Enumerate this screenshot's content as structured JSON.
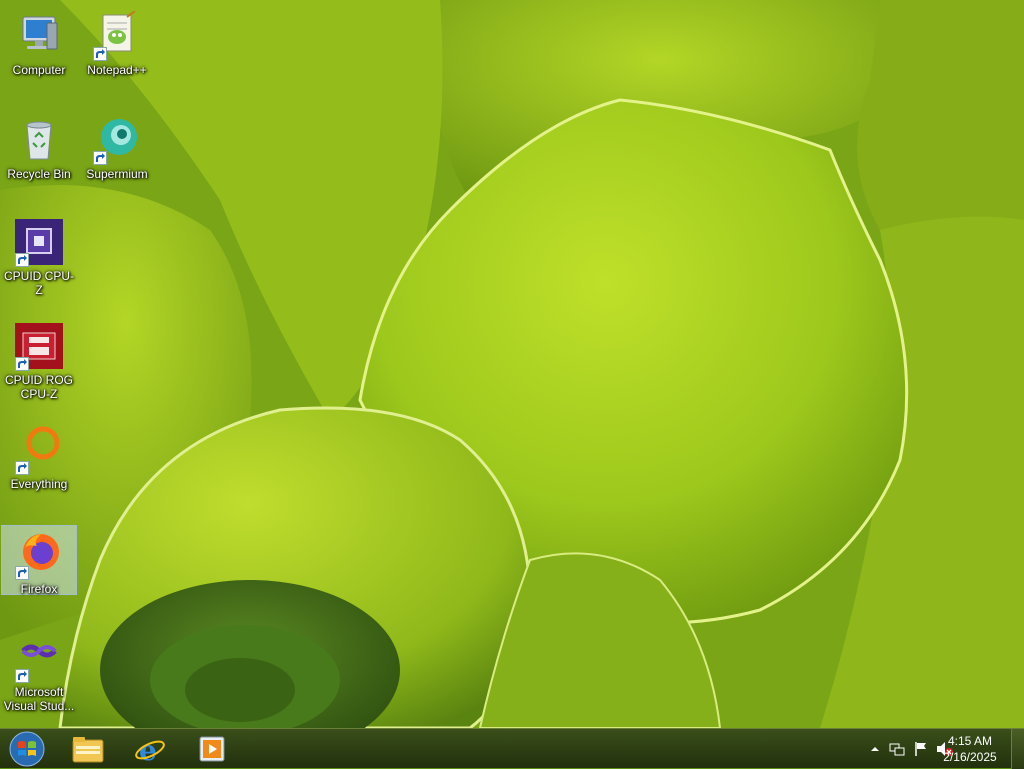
{
  "desktop": {
    "icons": [
      {
        "label": "Computer",
        "icon": "computer-icon"
      },
      {
        "label": "Notepad++",
        "icon": "notepadpp-icon"
      },
      {
        "label": "Recycle Bin",
        "icon": "recycle-bin-icon"
      },
      {
        "label": "Supermium",
        "icon": "supermium-icon"
      },
      {
        "label": "CPUID CPU-Z",
        "icon": "cpuz-icon"
      },
      {
        "label": "CPUID ROG CPU-Z",
        "icon": "rog-cpuz-icon"
      },
      {
        "label": "Everything",
        "icon": "everything-icon"
      },
      {
        "label": "Firefox",
        "icon": "firefox-icon",
        "selected": true
      },
      {
        "label": "Microsoft Visual Stud...",
        "icon": "visual-studio-icon"
      }
    ]
  },
  "taskbar": {
    "start_icon": "windows-start-icon",
    "pinned": [
      {
        "name": "Windows Explorer",
        "icon": "file-explorer-icon"
      },
      {
        "name": "Internet Explorer",
        "icon": "internet-explorer-icon"
      },
      {
        "name": "Windows Media Player",
        "icon": "media-player-icon"
      }
    ],
    "tray": {
      "icons": [
        "show-hidden-icons-icon",
        "network-icon",
        "action-center-flag-icon",
        "volume-muted-icon"
      ],
      "time": "4:15 AM",
      "date": "2/16/2025"
    }
  },
  "colors": {
    "wallpaper_base": "#5f8f12",
    "leaf_light": "#c6e02c",
    "leaf_mid": "#9bc11a",
    "taskbar": "#2b3a12"
  }
}
